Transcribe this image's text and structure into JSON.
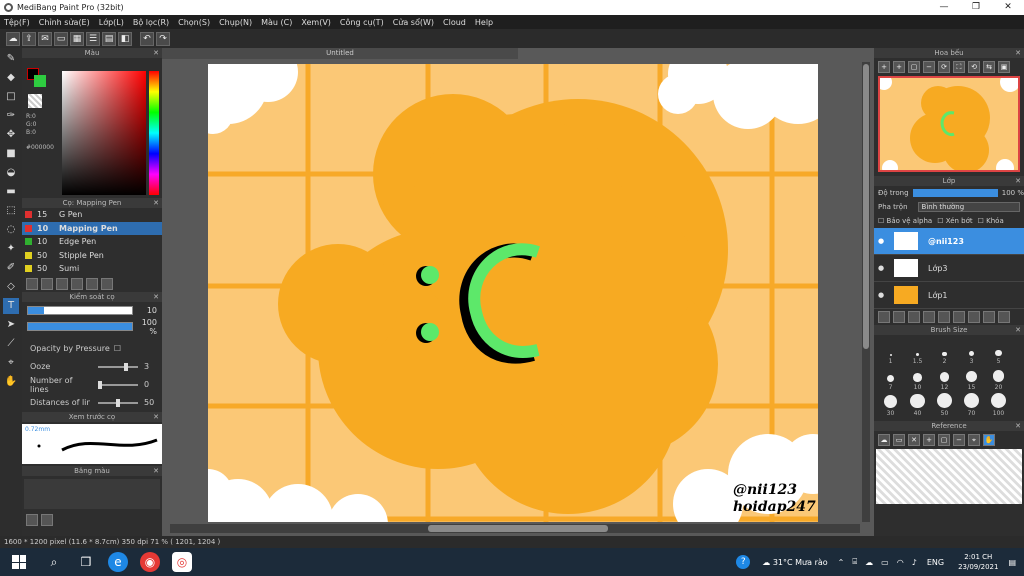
{
  "window": {
    "title": "MediBang Paint Pro (32bit)",
    "min": "—",
    "max": "❐",
    "close": "✕"
  },
  "menu": [
    "Tệp(F)",
    "Chỉnh sửa(E)",
    "Lớp(L)",
    "Bộ lọc(R)",
    "Chọn(S)",
    "Chụp(N)",
    "Màu (C)",
    "Xem(V)",
    "Công cụ(T)",
    "Cửa sổ(W)",
    "Cloud",
    "Help"
  ],
  "color_panel": {
    "title": "Màu",
    "r": "R:0",
    "g": "G:0",
    "b": "B:0",
    "hex": "#000000",
    "fg": "#000000",
    "bg": "#2ecc40"
  },
  "brush_panel": {
    "title": "Cọ: Mapping Pen",
    "items": [
      {
        "size": "15",
        "name": "G Pen",
        "color": "#e03030"
      },
      {
        "size": "10",
        "name": "Mapping Pen",
        "color": "#e03030",
        "selected": true
      },
      {
        "size": "10",
        "name": "Edge Pen",
        "color": "#30b030"
      },
      {
        "size": "50",
        "name": "Stipple Pen",
        "color": "#e0d020"
      },
      {
        "size": "50",
        "name": "Sumi",
        "color": "#e0d020"
      }
    ]
  },
  "brush_control": {
    "title": "Kiểm soát cọ",
    "size_value": "10",
    "size_fill": 0.15,
    "opacity_value": "100 %",
    "opacity_fill": 1.0,
    "opacity_by_pressure": "Opacity by Pressure",
    "ooze_label": "Ooze",
    "ooze_value": "3",
    "lines_label": "Number of lines",
    "lines_value": "0",
    "distances_label": "Distances of lines",
    "distances_value": "50"
  },
  "brush_preview": {
    "title": "Xem trước cọ",
    "size": "0.72mm"
  },
  "color_bag": {
    "title": "Băng màu"
  },
  "doc": {
    "tab": "Untitled"
  },
  "canvas_text": {
    "line1": "@nii123",
    "line2": "hoidap247"
  },
  "status": "1600 * 1200 pixel   (11.6 * 8.7cm)   350 dpi   71 %   ( 1201, 1204 )",
  "navigator": {
    "title": "Hoa bếu"
  },
  "layer_panel": {
    "title": "Lớp",
    "opacity_label": "Độ trong",
    "opacity_value": "100 %",
    "opacity_fill": 1.0,
    "blend_label": "Pha trộn",
    "blend_value": "Bình thường",
    "protect_alpha": "Bảo vệ alpha",
    "clipping": "Xén bớt",
    "lock": "Khóa",
    "layers": [
      {
        "name": "@nii123",
        "selected": true
      },
      {
        "name": "Lớp3",
        "selected": false
      },
      {
        "name": "Lớp1",
        "selected": false
      }
    ]
  },
  "brush_size": {
    "title": "Brush Size",
    "sizes": [
      "1",
      "1.5",
      "2",
      "3",
      "5",
      "7",
      "10",
      "12",
      "15",
      "20",
      "30",
      "40",
      "50",
      "70",
      "100"
    ]
  },
  "reference": {
    "title": "Reference"
  },
  "taskbar": {
    "weather": "31°C  Mưa rào",
    "lang": "ENG",
    "time": "2:01 CH",
    "date": "23/09/2021"
  }
}
